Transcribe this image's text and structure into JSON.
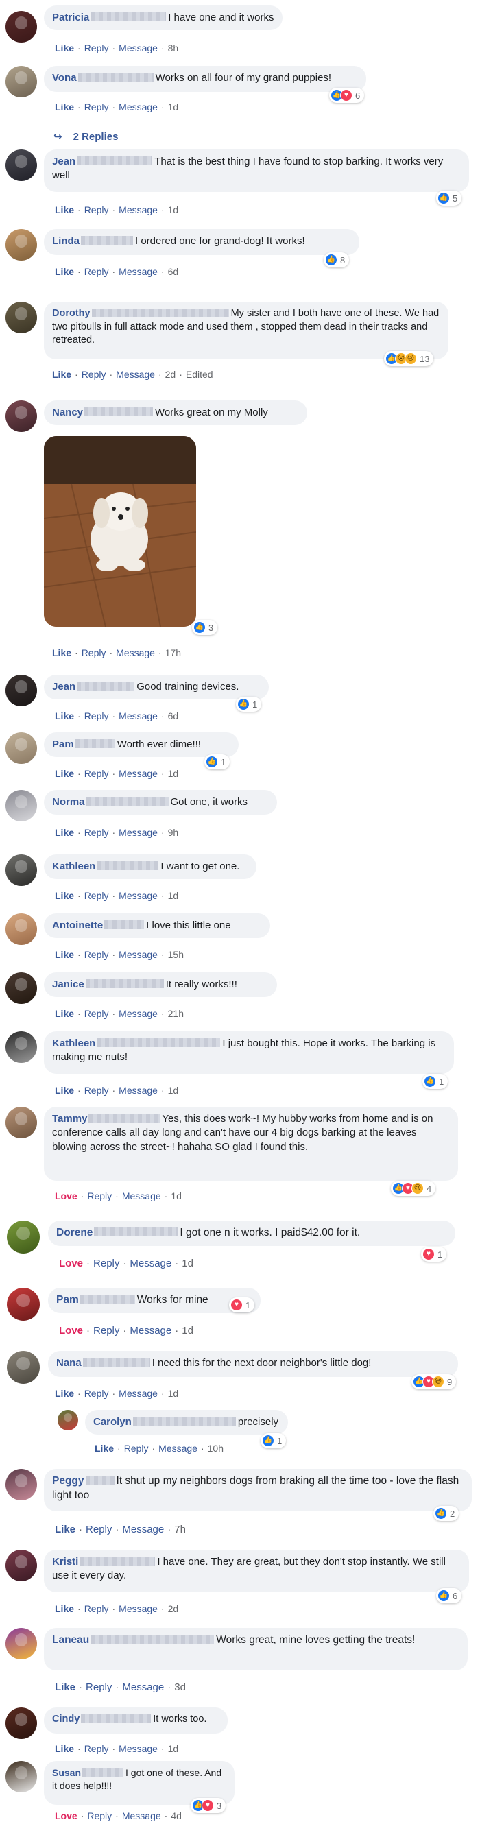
{
  "comments": [
    {
      "name": "Patricia",
      "text": "I have one and it works",
      "time": "8h",
      "reactions": [],
      "count": ""
    },
    {
      "name": "Vona",
      "text": "Works on all four of my grand puppies!",
      "time": "1d",
      "reactions": [
        "like",
        "love"
      ],
      "count": "6"
    },
    {
      "name": "Jean",
      "text": "That is the best thing I have found to stop barking. It works very well",
      "time": "1d",
      "reactions": [
        "like"
      ],
      "count": "5"
    },
    {
      "name": "Linda",
      "text": "I ordered one for grand-dog! It works!",
      "time": "6d",
      "reactions": [
        "like"
      ],
      "count": "8"
    },
    {
      "name": "Dorothy",
      "text": "My sister and I both have one of these. We had two pitbulls in full attack mode and used them , stopped them dead in their tracks and retreated.",
      "time": "2d",
      "edited": "Edited",
      "reactions": [
        "like",
        "wow",
        "sad"
      ],
      "count": "13"
    },
    {
      "name": "Nancy",
      "text": "Works great on my Molly",
      "time": "17h",
      "reactions": [
        "like"
      ],
      "count": "3"
    },
    {
      "name": "Jean",
      "text": "Good training devices.",
      "time": "6d",
      "reactions": [
        "like"
      ],
      "count": "1"
    },
    {
      "name": "Pam",
      "text": "Worth ever dime!!!",
      "time": "1d",
      "reactions": [
        "like"
      ],
      "count": "1"
    },
    {
      "name": "Norma",
      "text": "Got one, it works",
      "time": "9h",
      "reactions": [],
      "count": ""
    },
    {
      "name": "Kathleen",
      "text": "I want to get one.",
      "time": "1d",
      "reactions": [],
      "count": ""
    },
    {
      "name": "Antoinette",
      "text": "I love this little one",
      "time": "15h",
      "reactions": [],
      "count": ""
    },
    {
      "name": "Janice",
      "text": "It really works!!!",
      "time": "21h",
      "reactions": [],
      "count": ""
    },
    {
      "name": "Kathleen",
      "text": "I just bought this. Hope it works. The barking is making me nuts!",
      "time": "1d",
      "reactions": [
        "like"
      ],
      "count": "1"
    },
    {
      "name": "Tammy",
      "text": "Yes, this does work~! My hubby works from home and is on conference calls all day long and can't have our 4 big dogs barking at the leaves blowing across the street~! hahaha SO glad I found this.",
      "time": "1d",
      "liked": "Love",
      "reactions": [
        "like",
        "love",
        "sad"
      ],
      "count": "4"
    },
    {
      "name": "Dorene",
      "text": "I got one n it works. I paid$42.00 for it.",
      "time": "1d",
      "liked": "Love",
      "reactions": [
        "love"
      ],
      "count": "1"
    },
    {
      "name": "Pam",
      "text": "Works for mine",
      "time": "1d",
      "liked": "Love",
      "reactions": [
        "love"
      ],
      "count": "1"
    },
    {
      "name": "Nana",
      "text": "I need this for the next door neighbor's little dog!",
      "time": "1d",
      "reactions": [
        "like",
        "love",
        "haha"
      ],
      "count": "9"
    },
    {
      "name": "Carolyn",
      "text": "precisely",
      "time": "10h",
      "reactions": [
        "like"
      ],
      "count": "1"
    },
    {
      "name": "Peggy",
      "text": "It shut up my neighbors dogs from braking all the time too - love the flash light too",
      "time": "7h",
      "reactions": [
        "like"
      ],
      "count": "2"
    },
    {
      "name": "Kristi",
      "text": "I have one. They are great, but they don't stop instantly. We still use it every day.",
      "time": "2d",
      "reactions": [
        "like"
      ],
      "count": "6"
    },
    {
      "name": "Laneau",
      "text": "Works great, mine loves getting the treats!",
      "time": "3d",
      "reactions": [],
      "count": ""
    },
    {
      "name": "Cindy",
      "text": "It works too.",
      "time": "1d",
      "reactions": [],
      "count": ""
    },
    {
      "name": "Susan",
      "text": "I got one of these. And it does help!!!!",
      "time": "4d",
      "liked": "Love",
      "reactions": [
        "like",
        "love"
      ],
      "count": "3"
    }
  ],
  "labels": {
    "like": "Like",
    "reply": "Reply",
    "message": "Message",
    "dot": "·",
    "love": "Love"
  },
  "replies_label": "2 Replies",
  "colors": {
    "link": "#385898",
    "bubble": "#f0f2f5",
    "love": "#e0245e",
    "like_icon": "#1877f2",
    "love_icon": "#f33e58"
  }
}
